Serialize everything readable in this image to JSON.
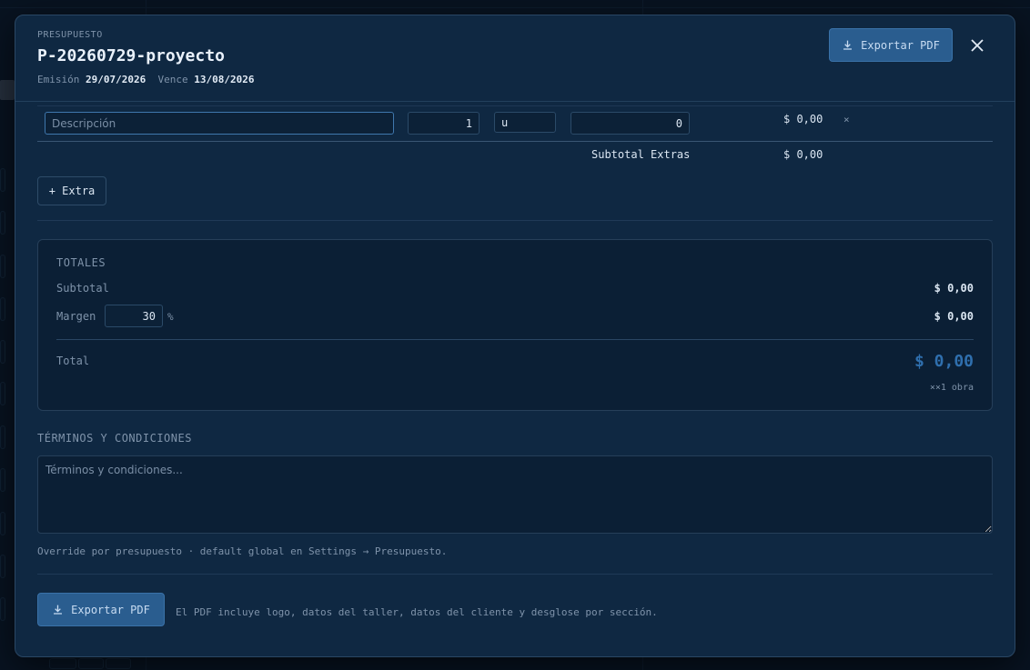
{
  "modal": {
    "eyebrow": "PRESUPUESTO",
    "title": "P-20260729-proyecto",
    "emision_label": "Emisión",
    "emision_value": "29/07/2026",
    "vence_label": "Vence",
    "vence_value": "13/08/2026",
    "export_label": "Exportar PDF",
    "close_icon": "close-icon"
  },
  "extra_row": {
    "description_placeholder": "Descripción",
    "quantity": "1",
    "unit": "u",
    "price": "0",
    "amount": "$ 0,00",
    "remove_symbol": "×"
  },
  "extras": {
    "subtotal_label": "Subtotal Extras",
    "subtotal_value": "$ 0,00",
    "add_label": "+ Extra"
  },
  "totals": {
    "heading": "TOTALES",
    "subtotal_label": "Subtotal",
    "subtotal_value": "$ 0,00",
    "margin_label": "Margen",
    "margin_value": "30",
    "margin_unit": "%",
    "margin_amount": "$ 0,00",
    "total_label": "Total",
    "total_value": "$ 0,00",
    "multiplier": "××1 obra"
  },
  "terms": {
    "heading": "TÉRMINOS Y CONDICIONES",
    "placeholder": "Términos y condiciones...",
    "note": "Override por presupuesto · default global en Settings → Presupuesto."
  },
  "footer": {
    "export_label": "Exportar PDF",
    "note": "El PDF incluye logo, datos del taller, datos del cliente y desglose por sección."
  },
  "colors": {
    "modal_bg": "#0f2842",
    "accent": "#2a5d8f",
    "total_accent": "#2f6fae"
  }
}
